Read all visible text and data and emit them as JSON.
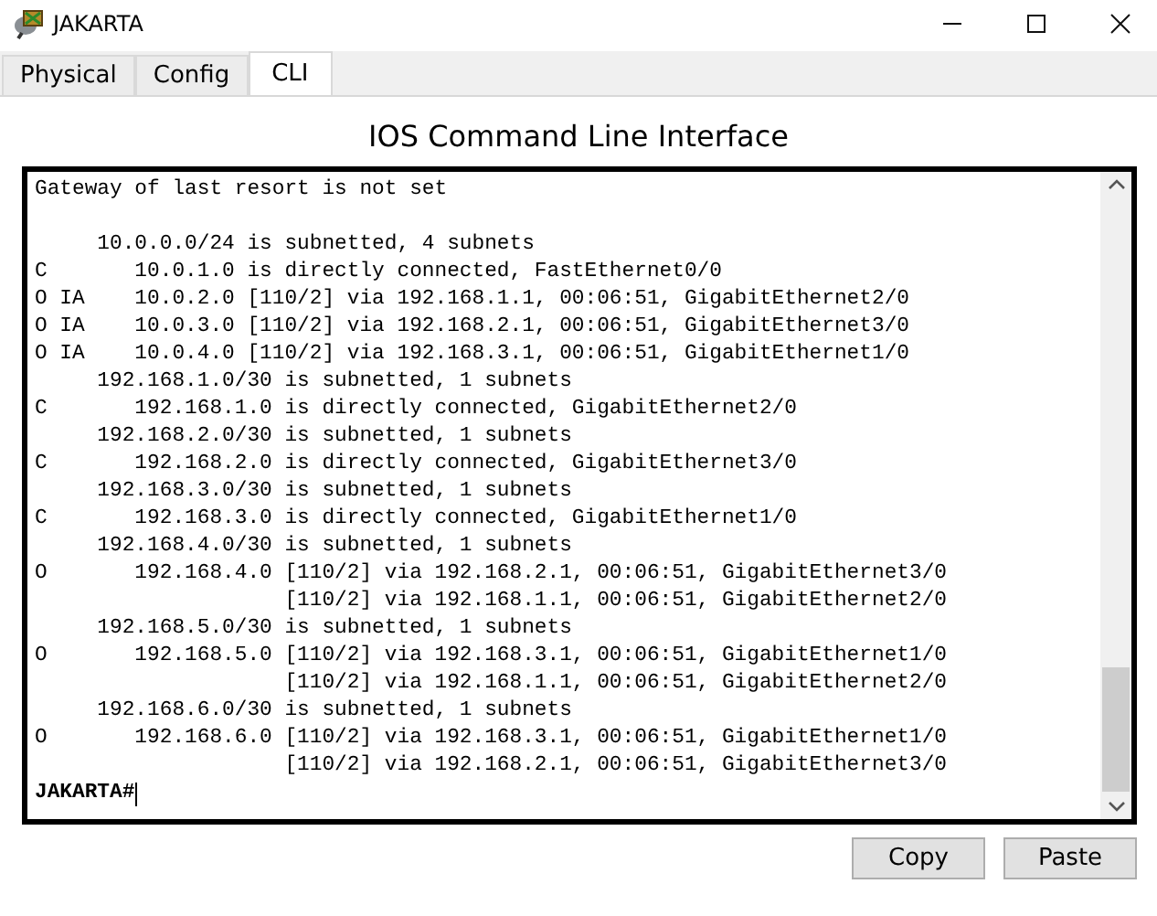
{
  "window": {
    "title": "JAKARTA"
  },
  "tabs": [
    {
      "label": "Physical",
      "selected": false
    },
    {
      "label": "Config",
      "selected": false
    },
    {
      "label": "CLI",
      "selected": true
    }
  ],
  "heading": "IOS Command Line Interface",
  "terminal": {
    "lines": [
      "Gateway of last resort is not set",
      "     10.0.0.0/24 is subnetted, 4 subnets",
      "C       10.0.1.0 is directly connected, FastEthernet0/0",
      "O IA    10.0.2.0 [110/2] via 192.168.1.1, 00:06:51, GigabitEthernet2/0",
      "O IA    10.0.3.0 [110/2] via 192.168.2.1, 00:06:51, GigabitEthernet3/0",
      "O IA    10.0.4.0 [110/2] via 192.168.3.1, 00:06:51, GigabitEthernet1/0",
      "     192.168.1.0/30 is subnetted, 1 subnets",
      "C       192.168.1.0 is directly connected, GigabitEthernet2/0",
      "     192.168.2.0/30 is subnetted, 1 subnets",
      "C       192.168.2.0 is directly connected, GigabitEthernet3/0",
      "     192.168.3.0/30 is subnetted, 1 subnets",
      "C       192.168.3.0 is directly connected, GigabitEthernet1/0",
      "     192.168.4.0/30 is subnetted, 1 subnets",
      "O       192.168.4.0 [110/2] via 192.168.2.1, 00:06:51, GigabitEthernet3/0",
      "                    [110/2] via 192.168.1.1, 00:06:51, GigabitEthernet2/0",
      "     192.168.5.0/30 is subnetted, 1 subnets",
      "O       192.168.5.0 [110/2] via 192.168.3.1, 00:06:51, GigabitEthernet1/0",
      "                    [110/2] via 192.168.1.1, 00:06:51, GigabitEthernet2/0",
      "     192.168.6.0/30 is subnetted, 1 subnets",
      "O       192.168.6.0 [110/2] via 192.168.3.1, 00:06:51, GigabitEthernet1/0",
      "                    [110/2] via 192.168.2.1, 00:06:51, GigabitEthernet3/0"
    ],
    "prompt": "JAKARTA#"
  },
  "buttons": [
    "Copy",
    "Paste"
  ]
}
